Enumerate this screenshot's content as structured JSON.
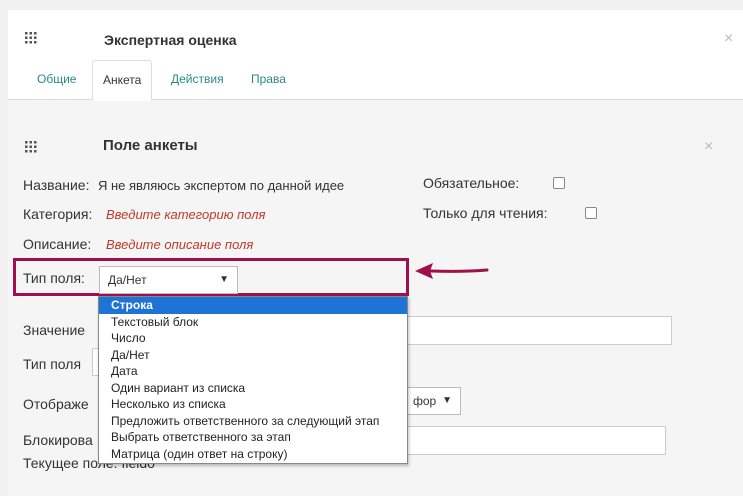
{
  "outer": {
    "title": "Экспертная оценка",
    "tabs": [
      {
        "label": "Общие"
      },
      {
        "label": "Анкета"
      },
      {
        "label": "Действия"
      },
      {
        "label": "Права"
      }
    ],
    "active_tab": "Анкета"
  },
  "field": {
    "title": "Поле анкеты",
    "name_label": "Название:",
    "name_value": "Я не являюсь экспертом по данной идее",
    "required_label": "Обязательное:",
    "required_checked": false,
    "category_label": "Категория:",
    "category_placeholder": "Введите категорию поля",
    "readonly_label": "Только для чтения:",
    "readonly_checked": false,
    "description_label": "Описание:",
    "description_placeholder": "Введите описание поля",
    "type_label": "Тип поля:",
    "type_value": "Да/Нет",
    "value_label": "Значение",
    "field_type2_label": "Тип поля",
    "display_label": "Отображе",
    "display_select_value": "фор",
    "block_label": "Блокирова",
    "current_field_label": "Текущее поле: fieldo"
  },
  "dropdown": {
    "options": [
      "Строка",
      "Текстовый блок",
      "Число",
      "Да/Нет",
      "Дата",
      "Один вариант из списка",
      "Несколько из списка",
      "Предложить ответственного за следующий этап",
      "Выбрать ответственного за этап",
      "Матрица (один ответ на строку)"
    ],
    "highlighted": "Строка"
  },
  "colors": {
    "highlight_frame": "#a0104a",
    "link_teal": "#2a8a8a",
    "placeholder_red": "#c0392b",
    "selected_option": "#1e73d6"
  },
  "icons": {
    "grip": "grip-icon",
    "close": "close-icon",
    "arrow": "arrow-left-icon"
  }
}
